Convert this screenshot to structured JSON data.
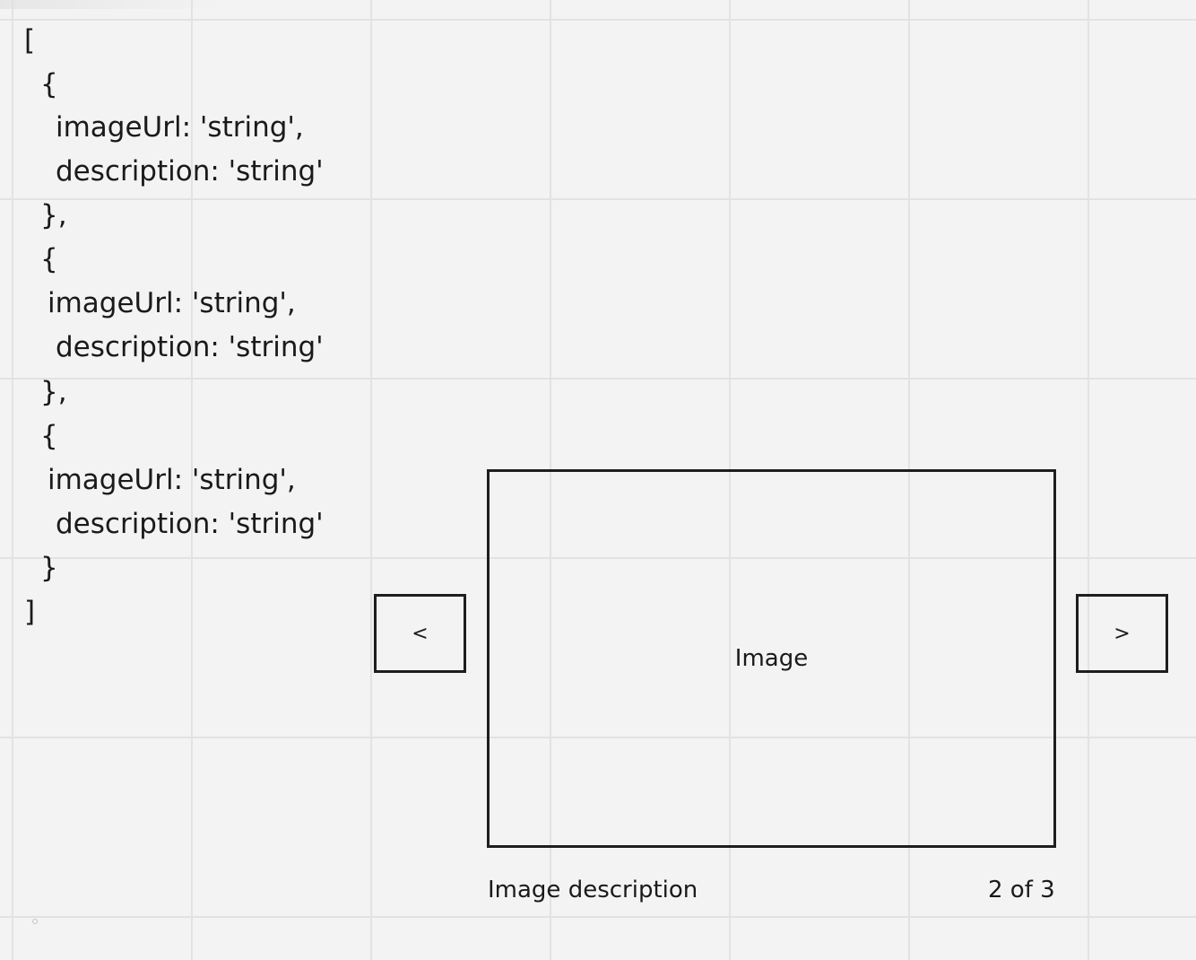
{
  "data_structure": {
    "lines": [
      "[",
      "{",
      "imageUrl: 'string',",
      "description: 'string'",
      "},",
      "{",
      "imageUrl: 'string',",
      "description: 'string'",
      "},",
      "{",
      "imageUrl: 'string',",
      "description: 'string'",
      "}",
      "]"
    ]
  },
  "carousel": {
    "prev_label": "<",
    "next_label": ">",
    "image_placeholder": "Image",
    "description": "Image description",
    "counter": "2 of 3"
  }
}
